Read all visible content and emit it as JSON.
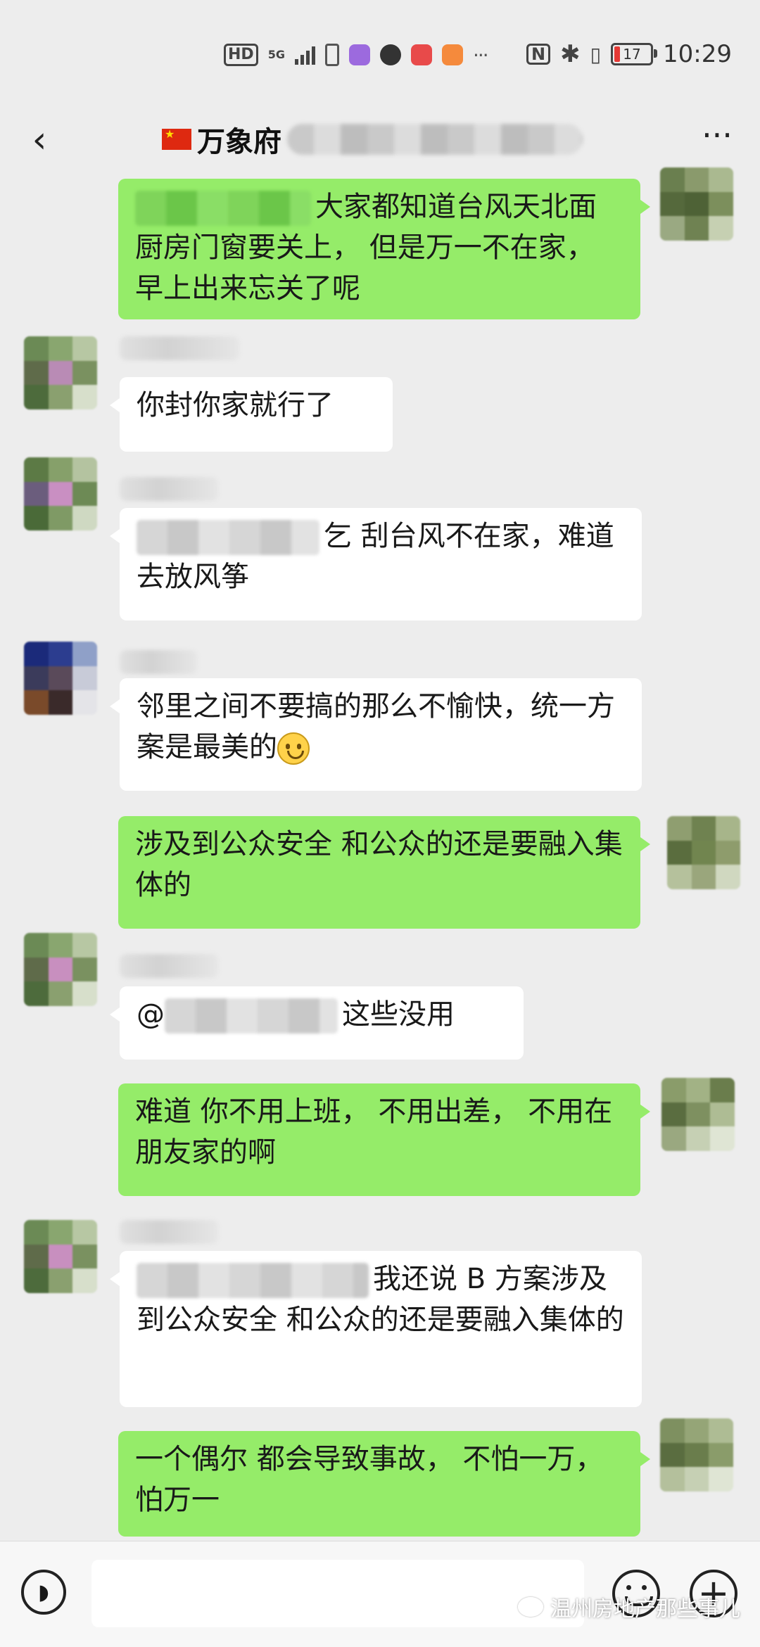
{
  "status_bar": {
    "hd": "HD",
    "network": "5G",
    "time": "10:29",
    "battery": "17",
    "nfc": "N",
    "bluetooth": "✱",
    "vibrate": "▯",
    "more": "···",
    "app_icons": [
      "#9c6ade",
      "#333333",
      "#e84a4a",
      "#f58a3c"
    ]
  },
  "header": {
    "title": "万象府",
    "back_icon": "‹",
    "more_icon": "···"
  },
  "messages": [
    {
      "side": "me",
      "text": "大家都知道台风天北面厨房门窗要关上， 但是万一不在家， 早上出来忘关了呢"
    },
    {
      "side": "them",
      "text": "你封你家就行了"
    },
    {
      "side": "them",
      "text": "乞  刮台风不在家，难道去放风筝"
    },
    {
      "side": "them",
      "text": "邻里之间不要搞的那么不愉快，统一方案是最美的"
    },
    {
      "side": "me",
      "text": "涉及到公众安全 和公众的还是要融入集体的"
    },
    {
      "side": "them",
      "prefix": "@",
      "text": "这些没用"
    },
    {
      "side": "me",
      "text": "难道 你不用上班， 不用出差， 不用在朋友家的啊"
    },
    {
      "side": "them",
      "text": "我还说 B 方案涉及到公众安全 和公众的还是要融入集体的"
    },
    {
      "side": "me",
      "text": "一个偶尔 都会导致事故， 不怕一万，怕万一"
    }
  ],
  "input_bar": {
    "voice_icon": "voice-icon",
    "emoji_icon": "emoji-icon",
    "plus_icon": "+"
  },
  "watermark": {
    "text": "温州房地产那些事儿"
  },
  "colors": {
    "bubble_me": "#95ec69",
    "bubble_them": "#ffffff",
    "background": "#ededed"
  }
}
